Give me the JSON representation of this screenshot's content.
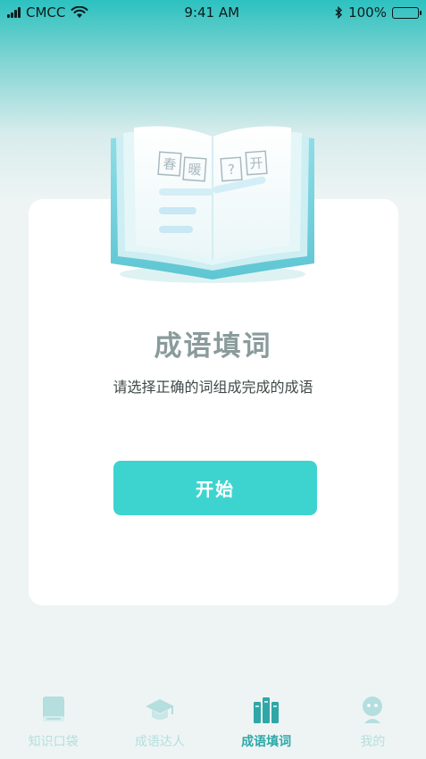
{
  "status_bar": {
    "carrier": "CMCC",
    "time": "9:41 AM",
    "battery": "100%"
  },
  "book_glyphs": [
    "春",
    "暖",
    "?",
    "开"
  ],
  "main": {
    "title": "成语填词",
    "subtitle": "请选择正确的词组成完成的成语",
    "start_label": "开始"
  },
  "tabs": [
    {
      "label": "知识口袋",
      "icon": "book-icon",
      "active": false
    },
    {
      "label": "成语达人",
      "icon": "graduation-cap-icon",
      "active": false
    },
    {
      "label": "成语填词",
      "icon": "books-icon",
      "active": true
    },
    {
      "label": "我的",
      "icon": "user-icon",
      "active": false
    }
  ],
  "colors": {
    "accent": "#3dd4cf",
    "tab_active": "#2fa7a7",
    "tab_inactive": "#b5dede",
    "title": "#8a9b9b"
  }
}
